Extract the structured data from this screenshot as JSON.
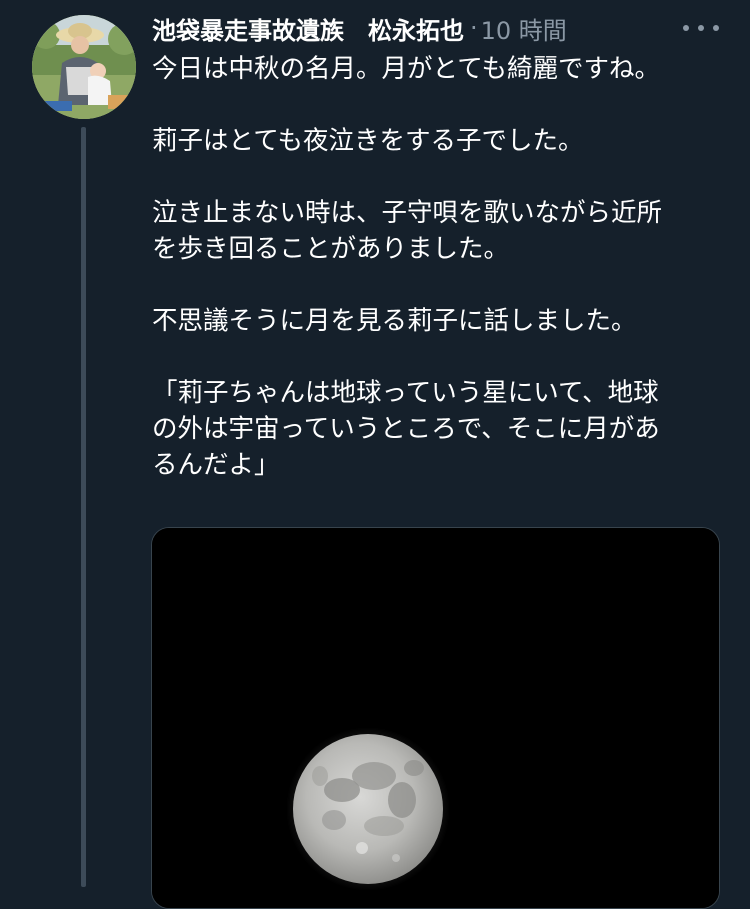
{
  "tweet": {
    "display_name": "池袋暴走事故遺族　松永拓也",
    "separator": "·",
    "timestamp": "10 時間",
    "body": [
      [
        "今日は中秋の名月。月がとても綺麗ですね。"
      ],
      [
        "莉子はとても夜泣きをする子でした。"
      ],
      [
        "泣き止まない時は、子守唄を歌いながら近所",
        "を歩き回ることがありました。"
      ],
      [
        "不思議そうに月を見る莉子に話しました。"
      ],
      [
        "「莉子ちゃんは地球っていう星にいて、地球",
        "の外は宇宙っていうところで、そこに月があ",
        "るんだよ」"
      ]
    ],
    "avatar_icon": "profile-photo",
    "more_icon": "more-horizontal-icon",
    "media_subject": "full-moon-photo"
  },
  "theme": {
    "background": "#15202b",
    "text": "#ffffff",
    "secondary_text": "#8b98a5",
    "thread_line": "#3d4b59"
  }
}
